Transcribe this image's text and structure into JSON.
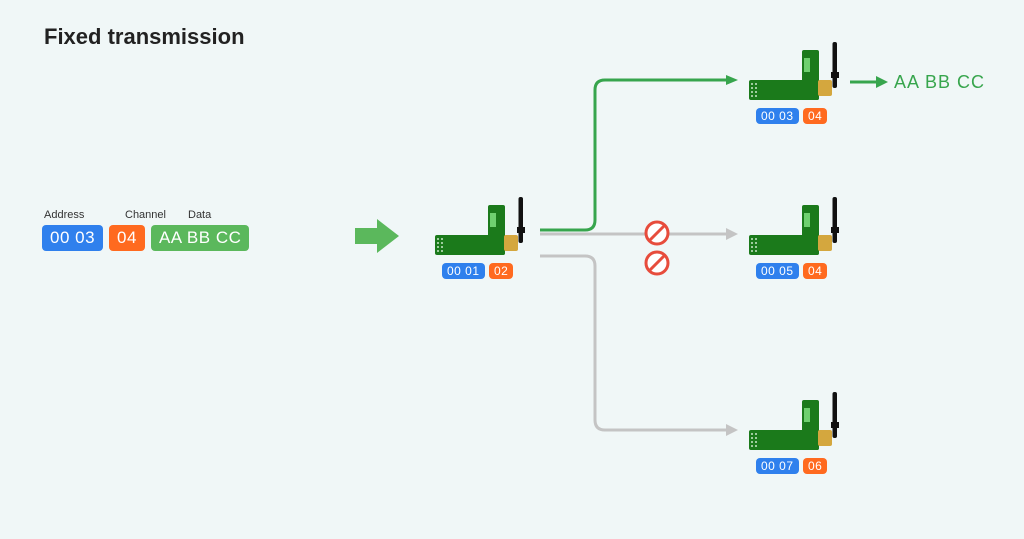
{
  "title": "Fixed transmission",
  "labels": {
    "address": "Address",
    "channel": "Channel",
    "data": "Data"
  },
  "packet": {
    "address": "00  03",
    "channel": "04",
    "data": "AA BB CC"
  },
  "sender": {
    "address": "00  01",
    "channel": "02"
  },
  "receivers": {
    "r1": {
      "address": "00  03",
      "channel": "04",
      "output": "AA BB CC"
    },
    "r2": {
      "address": "00  05",
      "channel": "04"
    },
    "r3": {
      "address": "00  07",
      "channel": "06"
    }
  }
}
